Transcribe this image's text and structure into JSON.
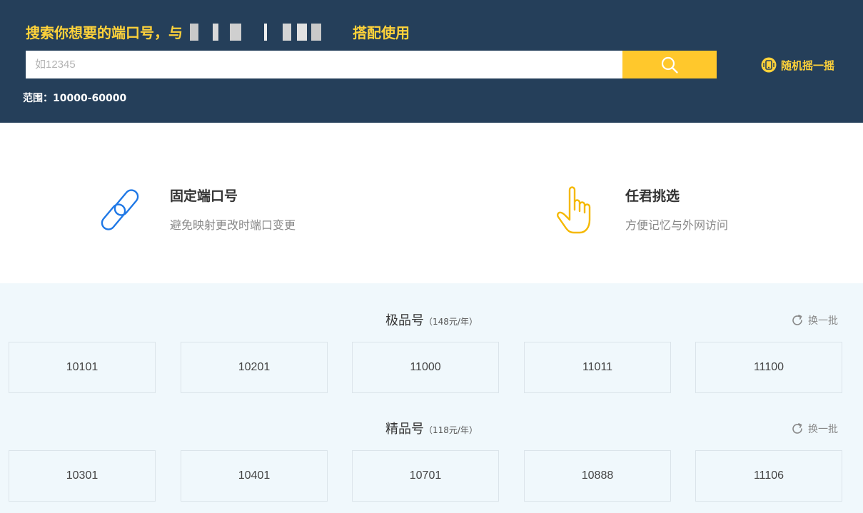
{
  "header": {
    "headline_left": "搜索你想要的端口号，与",
    "headline_right": "搭配使用",
    "search_placeholder": "如12345",
    "random_label": "随机摇一摇",
    "range_text": "范围：10000-60000"
  },
  "features": [
    {
      "title": "固定端口号",
      "desc": "避免映射更改时端口变更"
    },
    {
      "title": "任君挑选",
      "desc": "方便记忆与外网访问"
    }
  ],
  "sections": [
    {
      "title": "极品号",
      "price": "（148元/年）",
      "refresh": "换一批",
      "ports": [
        "10101",
        "10201",
        "11000",
        "11011",
        "11100"
      ]
    },
    {
      "title": "精品号",
      "price": "（118元/年）",
      "refresh": "换一批",
      "ports": [
        "10301",
        "10401",
        "10701",
        "10888",
        "11106"
      ]
    }
  ],
  "colors": {
    "header_bg": "#253f5a",
    "accent": "#ffc82c",
    "link_icon": "#1f78e6",
    "market_bg": "#f0f8fc"
  }
}
